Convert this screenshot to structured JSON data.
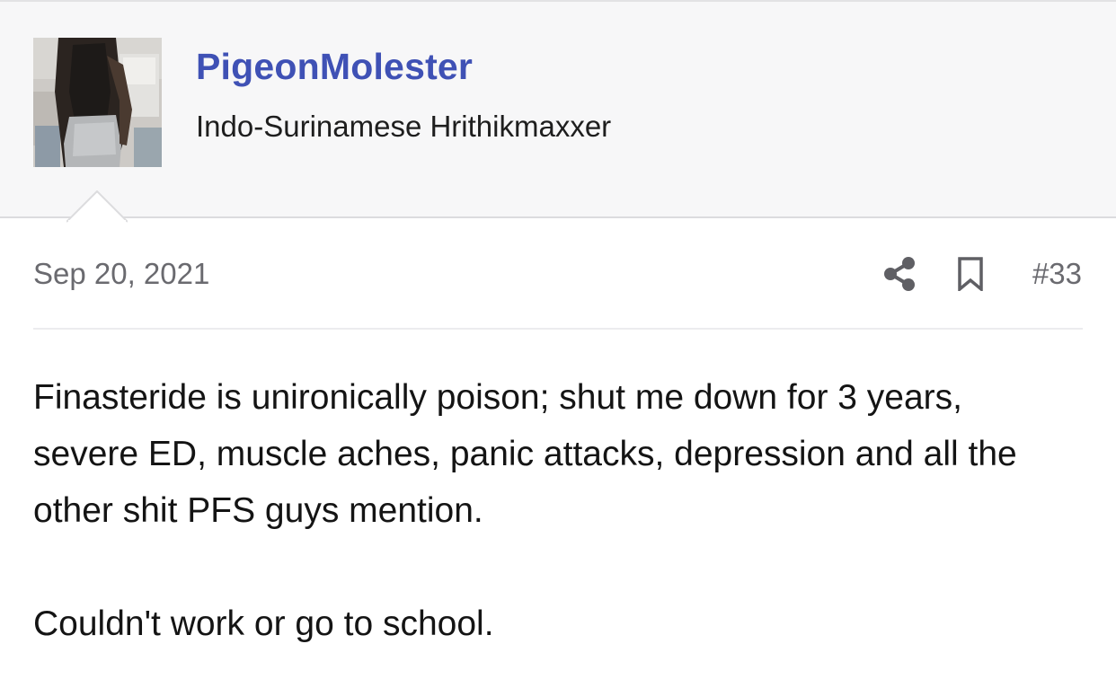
{
  "user": {
    "name": "PigeonMolester",
    "title": "Indo-Surinamese Hrithikmaxxer"
  },
  "post": {
    "date": "Sep 20, 2021",
    "number": "#33",
    "paragraphs": [
      "Finasteride is unironically poison; shut me down for 3 years, severe ED, muscle aches, panic attacks, depression and all the other shit PFS guys mention.",
      "Couldn't work or go to school."
    ]
  },
  "icons": {
    "share": "share-icon",
    "bookmark": "bookmark-icon"
  },
  "colors": {
    "username": "#3f51b5",
    "header_bg": "#f7f7f8",
    "meta_text": "#6a6a6f",
    "body_text": "#141414"
  }
}
